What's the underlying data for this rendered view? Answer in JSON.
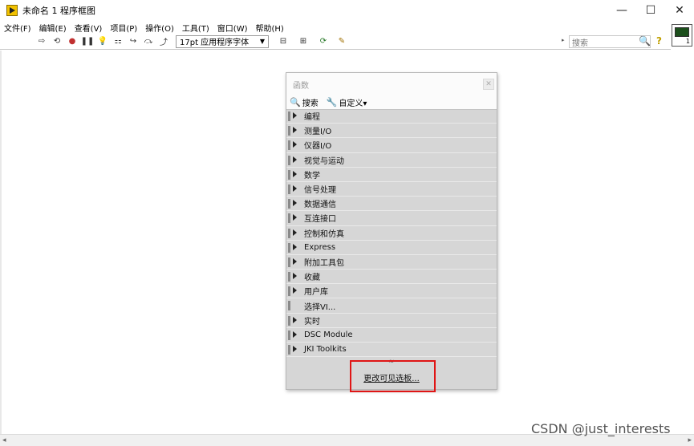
{
  "window": {
    "title": "未命名 1 程序框图",
    "minimize": "—",
    "maximize": "☐",
    "close": "✕"
  },
  "menu": [
    "文件(F)",
    "编辑(E)",
    "查看(V)",
    "项目(P)",
    "操作(O)",
    "工具(T)",
    "窗口(W)",
    "帮助(H)"
  ],
  "toolbar": {
    "font_select": "17pt 应用程序字体",
    "search_placeholder": "搜索",
    "vi_number": "1"
  },
  "palette": {
    "title": "函数",
    "search_label": "搜索",
    "customize_label": "自定义▾",
    "categories": [
      {
        "label": "编程",
        "has_arrow": true
      },
      {
        "label": "测量I/O",
        "has_arrow": true
      },
      {
        "label": "仪器I/O",
        "has_arrow": true
      },
      {
        "label": "视觉与运动",
        "has_arrow": true
      },
      {
        "label": "数学",
        "has_arrow": true
      },
      {
        "label": "信号处理",
        "has_arrow": true
      },
      {
        "label": "数据通信",
        "has_arrow": true
      },
      {
        "label": "互连接口",
        "has_arrow": true
      },
      {
        "label": "控制和仿真",
        "has_arrow": true
      },
      {
        "label": "Express",
        "has_arrow": true
      },
      {
        "label": "附加工具包",
        "has_arrow": true
      },
      {
        "label": "收藏",
        "has_arrow": true
      },
      {
        "label": "用户库",
        "has_arrow": true
      },
      {
        "label": "选择VI...",
        "has_arrow": false
      },
      {
        "label": "实时",
        "has_arrow": true
      },
      {
        "label": "DSC Module",
        "has_arrow": true
      },
      {
        "label": "JKI Toolkits",
        "has_arrow": true
      }
    ],
    "more_chevron": "≈",
    "change_visible_link": "更改可见选板..."
  },
  "watermark": "CSDN @just_interests",
  "colors": {
    "palette_bg": "#d6d6d6",
    "highlight": "#e01515"
  }
}
